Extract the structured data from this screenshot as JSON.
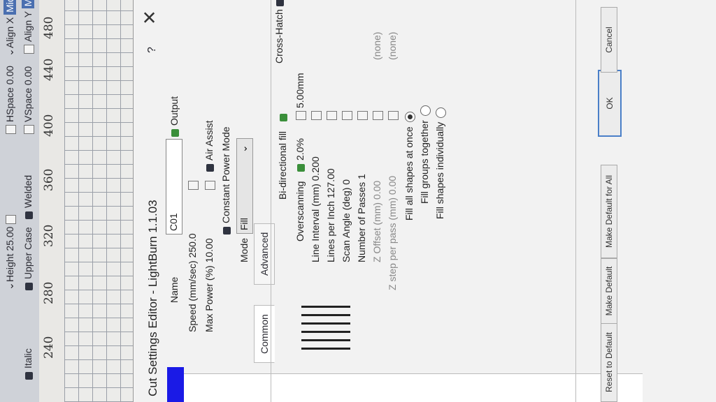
{
  "toolbar": {
    "italic": "Italic",
    "upper_case": "Upper Case",
    "welded": "Welded",
    "height": "Height 25.00",
    "hspace": "HSpace 0.00",
    "vspace": "VSpace 0.00",
    "align_x": "Align X",
    "align_y": "Align Y",
    "middle": "Middle"
  },
  "ruler": {
    "ticks": [
      "240",
      "280",
      "320",
      "360",
      "400",
      "440",
      "480"
    ]
  },
  "dialog": {
    "title": "Cut Settings Editor - LightBurn 1.1.03",
    "help": "?",
    "close": "✕",
    "name_label": "Name",
    "name_value": "C01",
    "output_label": "Output",
    "speed": "Speed (mm/sec) 250.0",
    "max_power": "Max Power (%) 10.00",
    "air_assist": "Air Assist",
    "constant_power": "Constant Power Mode",
    "mode_label": "Mode",
    "mode_value": "Fill",
    "tabs": {
      "common": "Common",
      "advanced": "Advanced"
    },
    "bidirectional": "Bi-directional fill",
    "cross_hatch": "Cross-Hatch",
    "overscanning": "Overscanning",
    "overscan_pct": "2.0%",
    "overscan_mm": "5.00mm",
    "line_interval": "Line Interval (mm) 0.200",
    "lines_per_inch": "Lines per Inch 127.00",
    "scan_angle": "Scan Angle (deg) 0",
    "num_passes": "Number of Passes 1",
    "z_offset": "Z Offset (mm) 0.00",
    "z_offset_none": "(none)",
    "z_step": "Z step per pass (mm) 0.00",
    "z_step_none": "(none)",
    "fill_all": "Fill all shapes at once",
    "fill_groups": "Fill groups together",
    "fill_individual": "Fill shapes individually",
    "buttons": {
      "reset": "Reset to Default",
      "make_default": "Make Default",
      "make_default_all": "Make Default for All",
      "ok": "OK",
      "cancel": "Cancel"
    }
  }
}
